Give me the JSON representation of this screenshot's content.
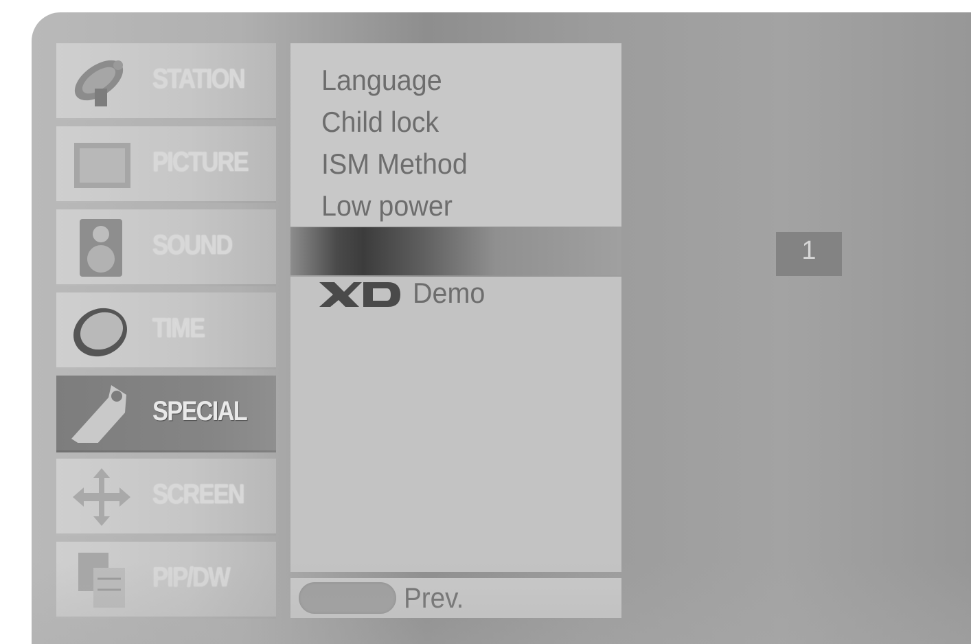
{
  "menu": {
    "categories": [
      {
        "label": "STATION",
        "icon": "satellite-dish-icon",
        "active": false
      },
      {
        "label": "PICTURE",
        "icon": "picture-frame-icon",
        "active": false
      },
      {
        "label": "SOUND",
        "icon": "speaker-icon",
        "active": false
      },
      {
        "label": "TIME",
        "icon": "clock-icon",
        "active": false
      },
      {
        "label": "SPECIAL",
        "icon": "tag-icon",
        "active": true
      },
      {
        "label": "SCREEN",
        "icon": "move-arrows-icon",
        "active": false
      },
      {
        "label": "PIP/DW",
        "icon": "pip-windows-icon",
        "active": false
      }
    ]
  },
  "submenu": {
    "items": [
      "Language",
      "Child lock",
      "ISM Method",
      "Low power"
    ],
    "highlighted_item": "",
    "xd_demo": {
      "logo": "XD",
      "label": "Demo"
    }
  },
  "footer": {
    "prev_label": "Prev."
  },
  "value_display": "1",
  "colors": {
    "panel": "#9a9a9a",
    "category_bg": "#c8c8c8",
    "category_active_bg": "#808080",
    "submenu_bg": "#c6c6c6",
    "text": "#6d6d6d",
    "highlight": "#3e3e3e"
  }
}
